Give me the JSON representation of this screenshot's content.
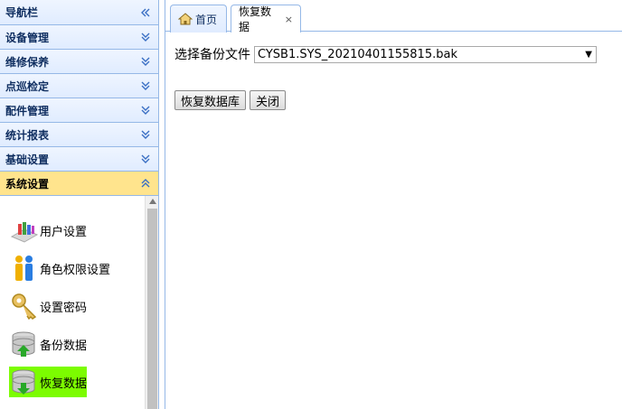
{
  "sidebar": {
    "title": "导航栏",
    "sections": [
      {
        "label": "设备管理"
      },
      {
        "label": "维修保养"
      },
      {
        "label": "点巡检定"
      },
      {
        "label": "配件管理"
      },
      {
        "label": "统计报表"
      },
      {
        "label": "基础设置"
      },
      {
        "label": "系统设置"
      }
    ],
    "items": [
      {
        "label": "用户设置",
        "icon": "users-settings-icon"
      },
      {
        "label": "角色权限设置",
        "icon": "role-permission-icon"
      },
      {
        "label": "设置密码",
        "icon": "key-icon"
      },
      {
        "label": "备份数据",
        "icon": "database-backup-icon"
      },
      {
        "label": "恢复数据",
        "icon": "database-restore-icon"
      }
    ]
  },
  "tabs": [
    {
      "label": "首页"
    },
    {
      "label": "恢复数据",
      "close": "×"
    }
  ],
  "form": {
    "select_label": "选择备份文件",
    "selected_file": "CYSB1.SYS_20210401155815.bak",
    "restore_button": "恢复数据库",
    "close_button": "关闭"
  },
  "colors": {
    "header_bg": "#e0ecff",
    "border": "#95b8e7",
    "active_section": "#ffe48d",
    "active_item": "#7cfc00"
  }
}
